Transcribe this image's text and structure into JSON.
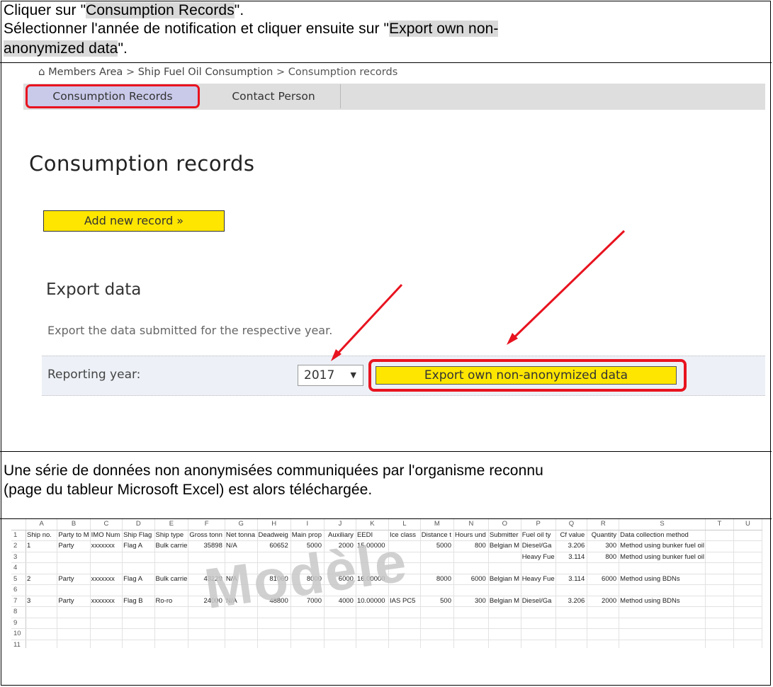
{
  "instructions": {
    "line1_pre": "Cliquer sur \"",
    "line1_hl": "Consumption Records",
    "line1_post": "\".",
    "line2_pre": "Sélectionner l'année de notification et cliquer ensuite sur \"",
    "line2_hl_a": "Export own non-",
    "line2_hl_b": "anonymized data",
    "line2_post": "\"."
  },
  "app": {
    "breadcrumb": {
      "home_icon": "home-icon",
      "members": "Members Area",
      "sep": ">",
      "section": "Ship Fuel Oil Consumption",
      "current": "Consumption records"
    },
    "tabs": [
      {
        "label": "Consumption Records"
      },
      {
        "label": "Contact Person"
      }
    ],
    "page_title": "Consumption records",
    "add_button": "Add new record »",
    "export_title": "Export data",
    "export_desc": "Export the data submitted for the respective year.",
    "year_label": "Reporting year:",
    "year_value": "2017",
    "year_caret": "▼",
    "export_button": "Export own non-anonymized data",
    "highlight_color": "#e8131f",
    "button_color": "#ffe600"
  },
  "result_text": {
    "line1": "Une série de données non anonymisées communiquées par l'organisme reconnu",
    "line2": "(page du tableur Microsoft Excel) est alors téléchargée."
  },
  "excel": {
    "columns": [
      "A",
      "B",
      "C",
      "D",
      "E",
      "F",
      "G",
      "H",
      "I",
      "J",
      "K",
      "L",
      "M",
      "N",
      "O",
      "P",
      "Q",
      "R",
      "S",
      "T",
      "U"
    ],
    "rows": [
      [
        "Ship no.",
        "Party to M",
        "IMO Num",
        "Ship Flag",
        "Ship type",
        "Gross tonn",
        "Net tonna",
        "Deadweig",
        "Main prop",
        "Auxiliary",
        "EEDI",
        "Ice class",
        "Distance t",
        "Hours und",
        "Submitter",
        "Fuel oil ty",
        "Cf value",
        "Quantity",
        "Data collection method",
        "",
        ""
      ],
      [
        "1",
        "Party",
        "xxxxxxx",
        "Flag A",
        "Bulk carrie",
        "35898",
        "N/A",
        "60652",
        "5000",
        "2000",
        "15.00000",
        "",
        "5000",
        "800",
        "Belgian M",
        "Diesel/Ga",
        "3.206",
        "300",
        "Method using bunker fuel oil",
        "",
        ""
      ],
      [
        "",
        "",
        "",
        "",
        "",
        "",
        "",
        "",
        "",
        "",
        "",
        "",
        "",
        "",
        "",
        "Heavy Fue",
        "3.114",
        "800",
        "Method using bunker fuel oil",
        "",
        ""
      ],
      [
        "",
        "",
        "",
        "",
        "",
        "",
        "",
        "",
        "",
        "",
        "",
        "",
        "",
        "",
        "",
        "",
        "",
        "",
        "",
        "",
        ""
      ],
      [
        "2",
        "Party",
        "xxxxxxx",
        "Flag A",
        "Bulk carrie",
        "43229",
        "N/A",
        "81060",
        "8000",
        "6000",
        "16.00000",
        "",
        "8000",
        "6000",
        "Belgian M",
        "Heavy Fue",
        "3.114",
        "6000",
        "Method using BDNs",
        "",
        ""
      ],
      [
        "",
        "",
        "",
        "",
        "",
        "",
        "",
        "",
        "",
        "",
        "",
        "",
        "",
        "",
        "",
        "",
        "",
        "",
        "",
        "",
        ""
      ],
      [
        "3",
        "Party",
        "xxxxxxx",
        "Flag B",
        "Ro-ro",
        "24000",
        "N/A",
        "48800",
        "7000",
        "4000",
        "10.00000",
        "IAS PC5",
        "500",
        "300",
        "Belgian M",
        "Diesel/Ga",
        "3.206",
        "2000",
        "Method using BDNs",
        "",
        ""
      ],
      [
        "",
        "",
        "",
        "",
        "",
        "",
        "",
        "",
        "",
        "",
        "",
        "",
        "",
        "",
        "",
        "",
        "",
        "",
        "",
        "",
        ""
      ],
      [
        "",
        "",
        "",
        "",
        "",
        "",
        "",
        "",
        "",
        "",
        "",
        "",
        "",
        "",
        "",
        "",
        "",
        "",
        "",
        "",
        ""
      ],
      [
        "",
        "",
        "",
        "",
        "",
        "",
        "",
        "",
        "",
        "",
        "",
        "",
        "",
        "",
        "",
        "",
        "",
        "",
        "",
        "",
        ""
      ],
      [
        "",
        "",
        "",
        "",
        "",
        "",
        "",
        "",
        "",
        "",
        "",
        "",
        "",
        "",
        "",
        "",
        "",
        "",
        "",
        "",
        ""
      ]
    ],
    "watermark": "Modèle"
  }
}
